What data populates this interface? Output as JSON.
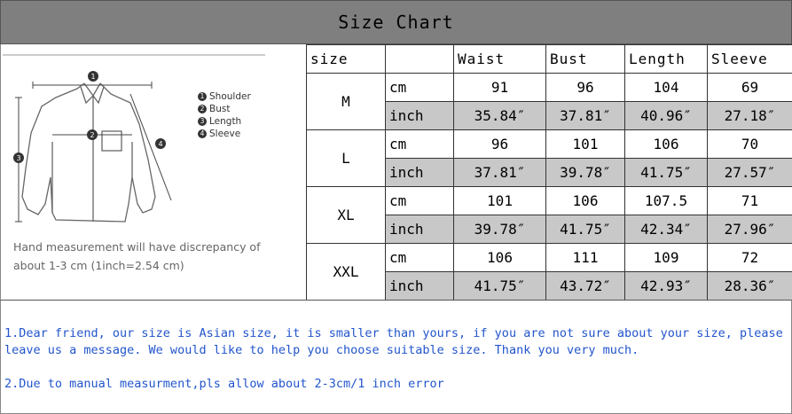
{
  "title": "Size Chart",
  "diagram": {
    "legend": [
      {
        "num": "1",
        "label": "Shoulder"
      },
      {
        "num": "2",
        "label": "Bust"
      },
      {
        "num": "3",
        "label": "Length"
      },
      {
        "num": "4",
        "label": "Sleeve"
      }
    ],
    "note_line1": "Hand measurement will have discrepancy of",
    "note_line2": "about 1-3 cm (1inch=2.54 cm)",
    "markers": [
      "1",
      "2",
      "3",
      "4"
    ],
    "illustration": "shirt-illustration"
  },
  "table": {
    "headers": [
      "size",
      "",
      "Waist",
      "Bust",
      "Length",
      "Sleeve"
    ],
    "rows": [
      {
        "size": "M",
        "cm": {
          "unit": "cm",
          "values": [
            "91",
            "96",
            "104",
            "69"
          ]
        },
        "inch": {
          "unit": "inch",
          "values": [
            "35.84″",
            "37.81″",
            "40.96″",
            "27.18″"
          ]
        }
      },
      {
        "size": "L",
        "cm": {
          "unit": "cm",
          "values": [
            "96",
            "101",
            "106",
            "70"
          ]
        },
        "inch": {
          "unit": "inch",
          "values": [
            "37.81″",
            "39.78″",
            "41.75″",
            "27.57″"
          ]
        }
      },
      {
        "size": "XL",
        "cm": {
          "unit": "cm",
          "values": [
            "101",
            "106",
            "107.5",
            "71"
          ]
        },
        "inch": {
          "unit": "inch",
          "values": [
            "39.78″",
            "41.75″",
            "42.34″",
            "27.96″"
          ]
        }
      },
      {
        "size": "XXL",
        "cm": {
          "unit": "cm",
          "values": [
            "106",
            "111",
            "109",
            "72"
          ]
        },
        "inch": {
          "unit": "inch",
          "values": [
            "41.75″",
            "43.72″",
            "42.93″",
            "28.36″"
          ]
        }
      }
    ]
  },
  "notes": [
    "1.Dear friend, our size is Asian size, it is smaller than yours, if you are not sure about your size, please leave us a message. We would like to help you choose suitable size. Thank you very much.",
    "2.Due to manual measurment,pls allow about 2-3cm/1 inch error"
  ],
  "colors": {
    "title_bar": "#7f7f7f",
    "inch_row": "#c8c8c8",
    "notes_text": "#2255cc"
  }
}
